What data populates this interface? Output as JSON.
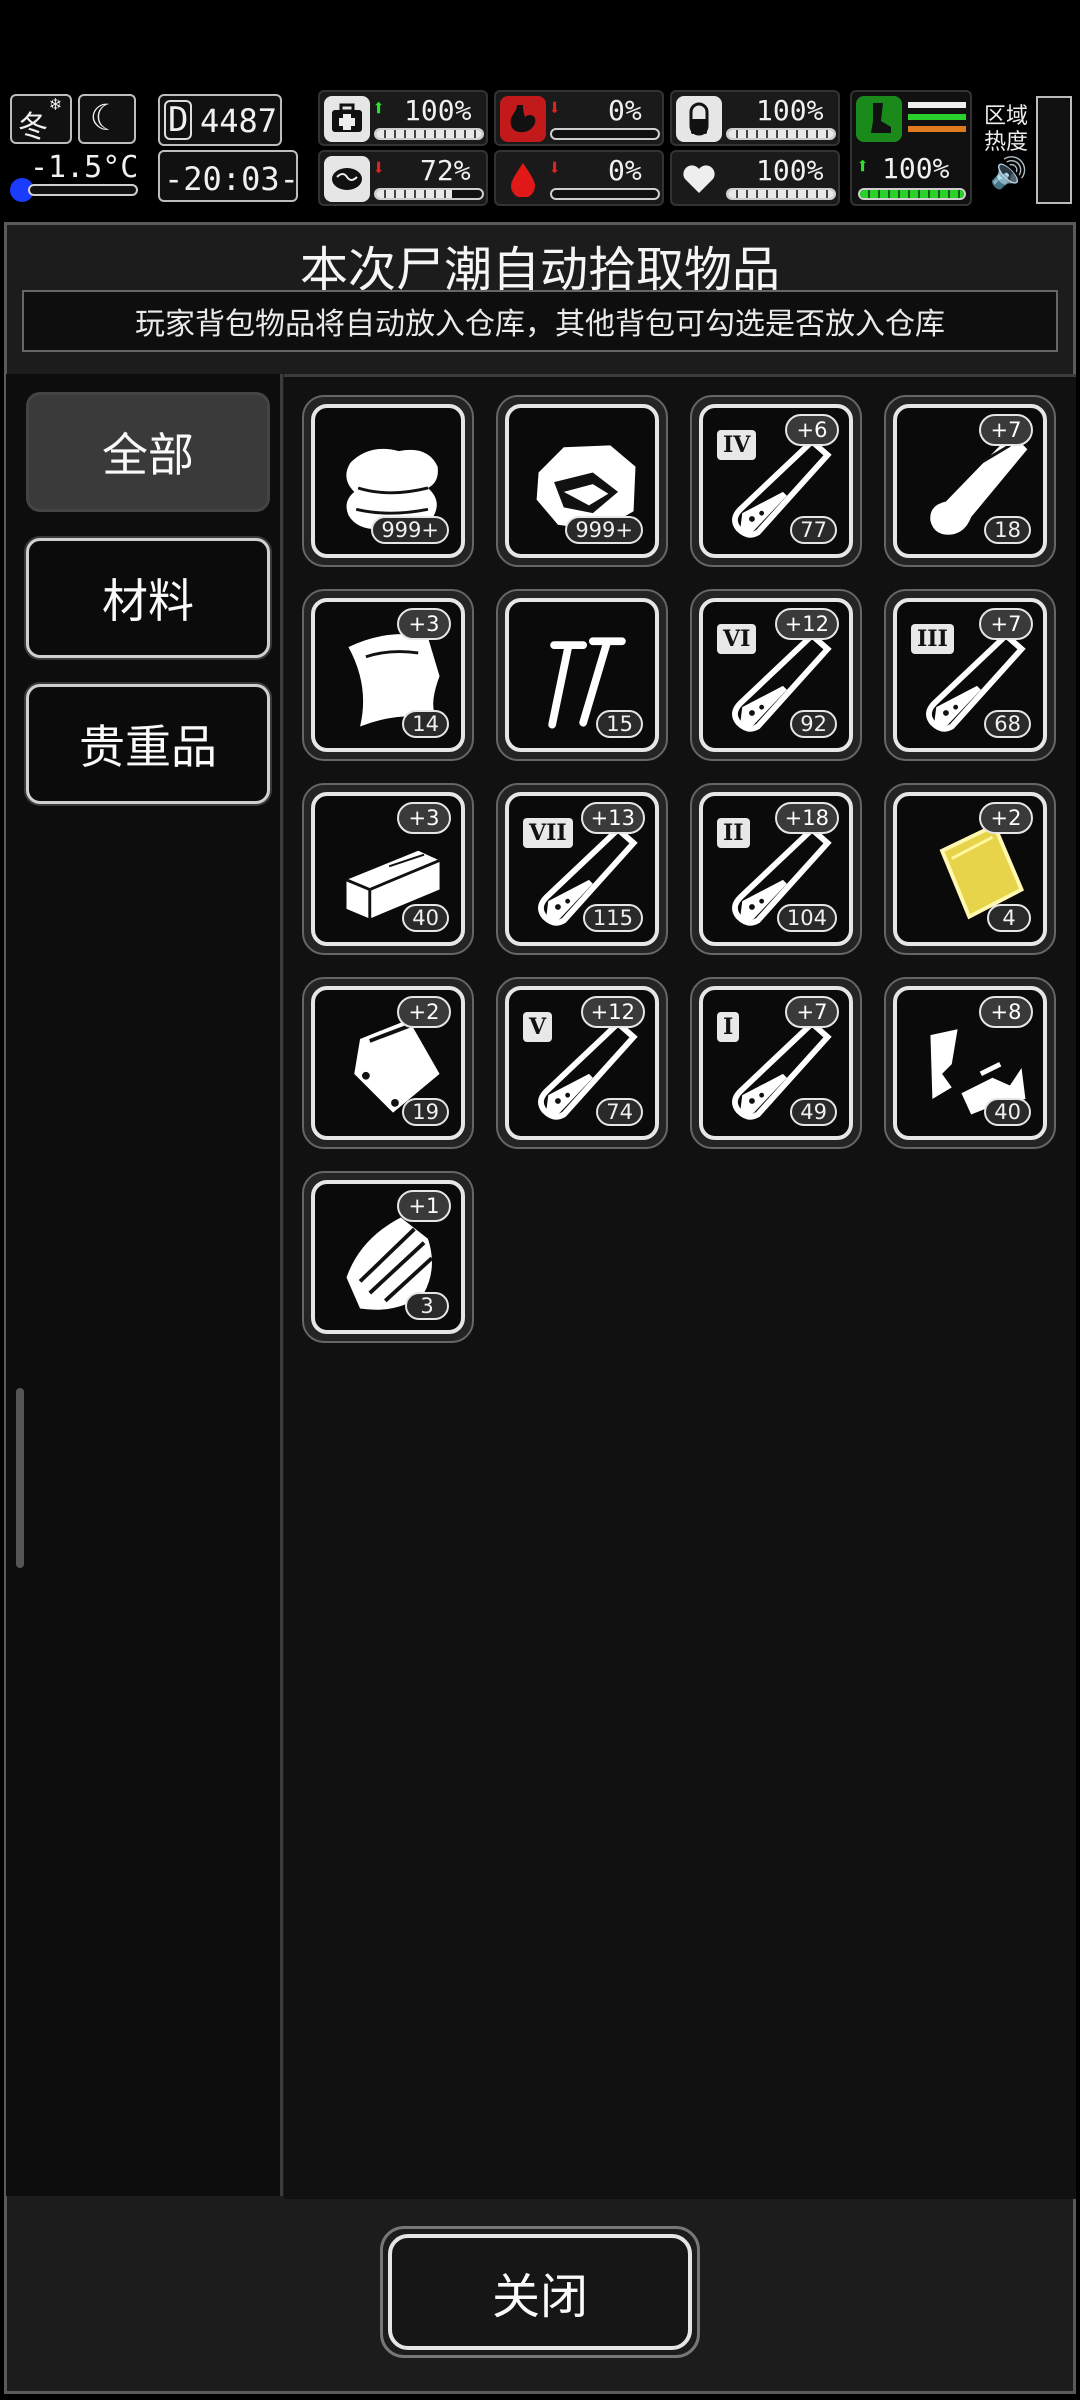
{
  "hud": {
    "season": "冬",
    "temperature": "-1.5°C",
    "day": "4487",
    "day_prefix": "D",
    "time": "-20:03-",
    "health": "100%",
    "stomach": "0%",
    "pill": "100%",
    "brain": "72%",
    "blood": "0%",
    "heart": "100%",
    "stamina": "100%",
    "zone_heat_label": "区域热度"
  },
  "dialog": {
    "title": "本次尸潮自动拾取物品",
    "subtitle": "玩家背包物品将自动放入仓库，其他背包可勾选是否放入仓库",
    "close": "关闭"
  },
  "tabs": [
    {
      "label": "全部",
      "active": true
    },
    {
      "label": "材料",
      "active": false
    },
    {
      "label": "贵重品",
      "active": false
    }
  ],
  "items": [
    {
      "icon": "cloth-icon",
      "count": "999+",
      "bonus": "",
      "roman": ""
    },
    {
      "icon": "meat-icon",
      "count": "999+",
      "bonus": "",
      "roman": ""
    },
    {
      "icon": "serum-tube-icon",
      "count": "77",
      "bonus": "+6",
      "roman": "IV"
    },
    {
      "icon": "bone-icon",
      "count": "18",
      "bonus": "+7",
      "roman": ""
    },
    {
      "icon": "fabric-sheet-icon",
      "count": "14",
      "bonus": "+3",
      "roman": ""
    },
    {
      "icon": "screws-icon",
      "count": "15",
      "bonus": "",
      "roman": ""
    },
    {
      "icon": "serum-tube-icon",
      "count": "92",
      "bonus": "+12",
      "roman": "VI"
    },
    {
      "icon": "serum-tube-icon",
      "count": "68",
      "bonus": "+7",
      "roman": "III"
    },
    {
      "icon": "plank-icon",
      "count": "40",
      "bonus": "+3",
      "roman": ""
    },
    {
      "icon": "serum-tube-icon",
      "count": "115",
      "bonus": "+13",
      "roman": "VII"
    },
    {
      "icon": "serum-tube-icon",
      "count": "104",
      "bonus": "+18",
      "roman": "II"
    },
    {
      "icon": "gold-plate-icon",
      "count": "4",
      "bonus": "+2",
      "roman": ""
    },
    {
      "icon": "bag-icon",
      "count": "19",
      "bonus": "+2",
      "roman": ""
    },
    {
      "icon": "serum-tube-icon",
      "count": "74",
      "bonus": "+12",
      "roman": "V"
    },
    {
      "icon": "serum-tube-icon",
      "count": "49",
      "bonus": "+7",
      "roman": "I"
    },
    {
      "icon": "scrap-metal-icon",
      "count": "40",
      "bonus": "+8",
      "roman": ""
    },
    {
      "icon": "wood-shard-icon",
      "count": "3",
      "bonus": "+1",
      "roman": ""
    }
  ],
  "colors": {
    "accent_green": "#2ee02e",
    "accent_red": "#e02222",
    "gold": "#e8d44a"
  }
}
